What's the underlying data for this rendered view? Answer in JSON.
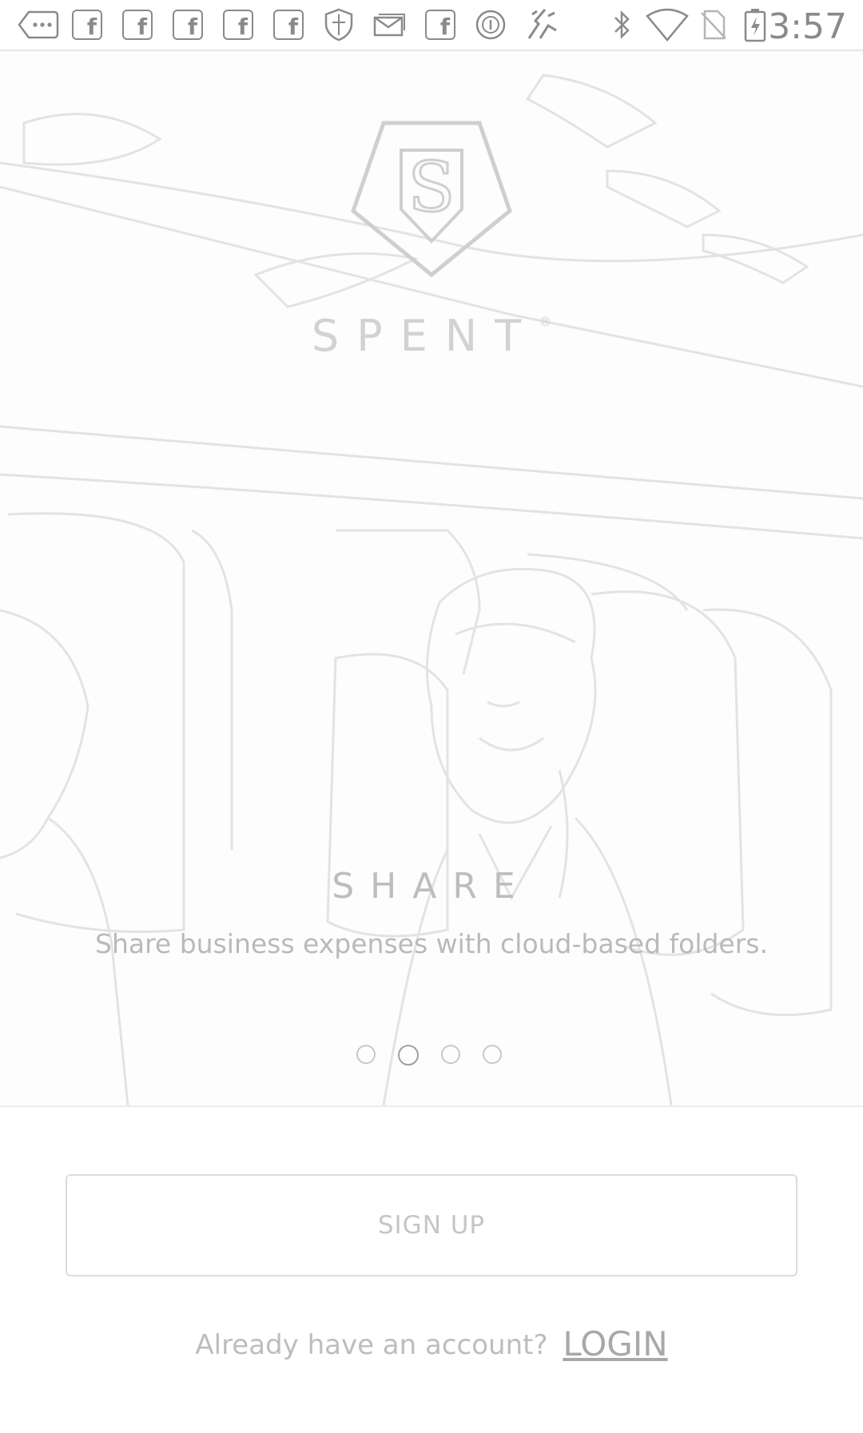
{
  "status_bar": {
    "time": "3:57",
    "left_icons": [
      "more-icon",
      "facebook-icon",
      "facebook-icon",
      "facebook-icon",
      "facebook-icon",
      "facebook-icon",
      "shield-icon",
      "mail-icon",
      "facebook-icon",
      "circle-icon",
      "fire-icon"
    ],
    "right_icons": [
      "bluetooth-icon",
      "wifi-icon",
      "no-sim-icon",
      "battery-charging-icon"
    ]
  },
  "hero": {
    "brand": "SPENT",
    "brand_mark": "®",
    "logo_letter": "S",
    "slide_title": "SHARE",
    "slide_description": "Share business expenses with cloud-based folders.",
    "pagination": {
      "total": 4,
      "active": 2
    }
  },
  "actions": {
    "signup_label": "SIGN UP",
    "login_prompt": "Already have an account?",
    "login_label": "LOGIN"
  }
}
